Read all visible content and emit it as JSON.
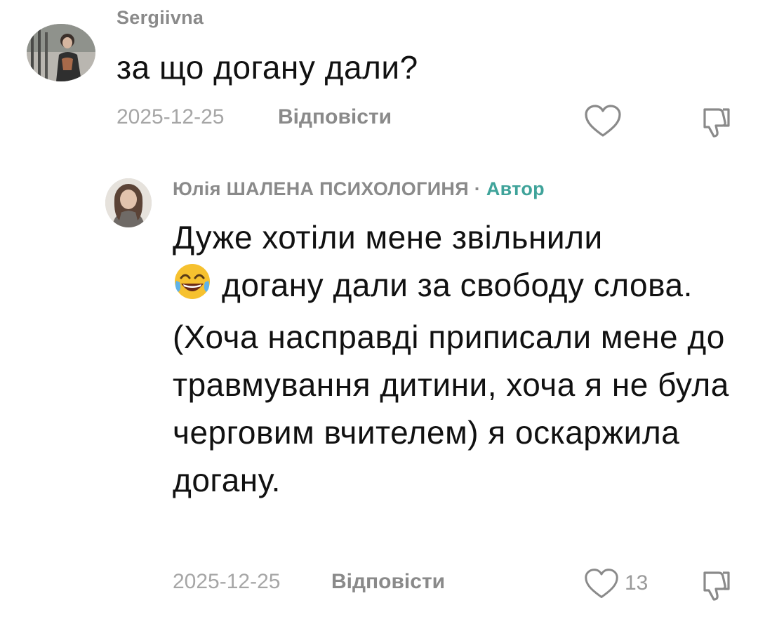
{
  "comments": [
    {
      "username": "Sergiivna",
      "text": "за що догану дали?",
      "date": "2025-12-25",
      "reply_label": "Відповісти",
      "like_count": "",
      "avatar_icon": "user-photo-avatar",
      "like_icon": "heart-outline-icon",
      "dislike_icon": "thumbs-down-icon"
    }
  ],
  "reply": {
    "username": "Юлія ШАЛЕНА ПСИХОЛОГИНЯ",
    "separator": "·",
    "author_badge": "Автор",
    "text_emoji": "😂",
    "text_line1": "Дуже хотіли мене звільнили",
    "text_rest": "догану дали за свободу слова. (Хоча насправді приписали мене до травмування дитини, хоча я не була черговим вчителем) я оскаржила догану.",
    "date": "2025-12-25",
    "reply_label": "Відповісти",
    "like_count": "13",
    "avatar_icon": "user-photo-avatar",
    "like_icon": "heart-outline-icon",
    "dislike_icon": "thumbs-down-icon"
  },
  "colors": {
    "text": "#111111",
    "muted": "#8a8a8a",
    "date": "#a6a6a6",
    "author_accent": "#3fa39a"
  }
}
